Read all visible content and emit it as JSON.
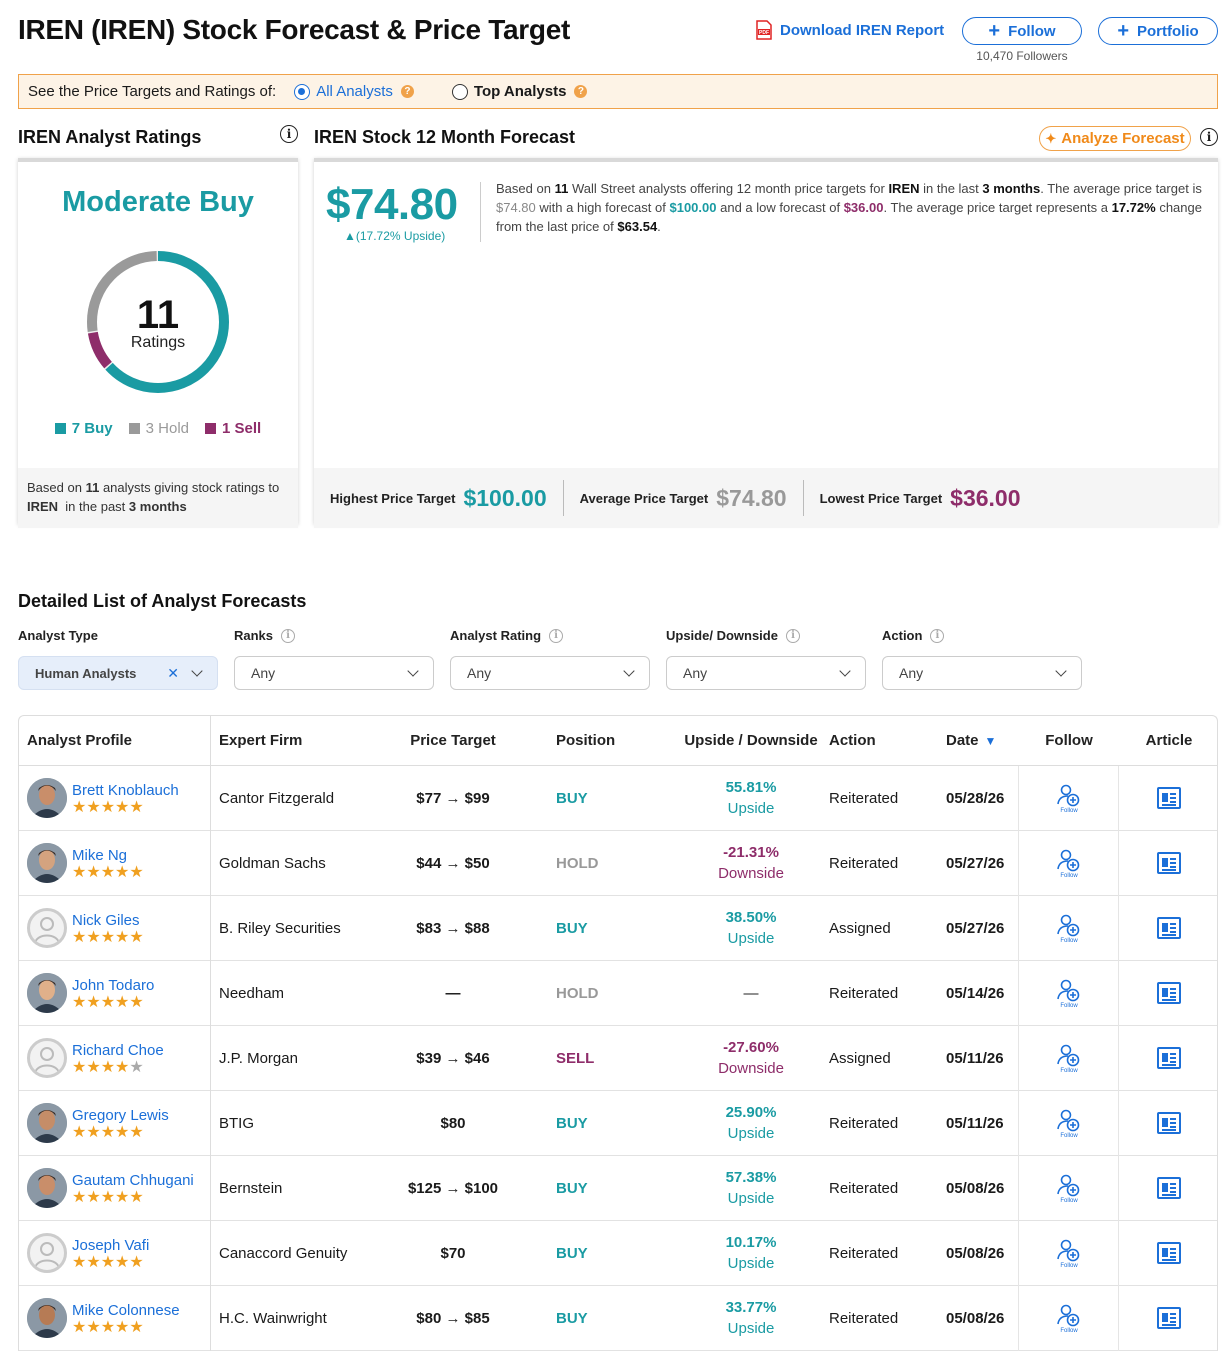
{
  "header": {
    "title": "IREN (IREN) Stock Forecast & Price Target",
    "download_label": "Download IREN Report",
    "follow_label": "Follow",
    "portfolio_label": "Portfolio",
    "followers": "10,470 Followers"
  },
  "filter": {
    "prompt": "See the Price Targets and Ratings of:",
    "all_analysts": "All Analysts",
    "top_analysts": "Top Analysts",
    "selected": "All Analysts"
  },
  "ratings": {
    "title": "IREN Analyst Ratings",
    "consensus": "Moderate Buy",
    "count": "11",
    "count_word": "Ratings",
    "buy": 7,
    "hold": 3,
    "sell": 1,
    "buy_label": "7 Buy",
    "hold_label": "3 Hold",
    "sell_label": "1 Sell",
    "colors": {
      "buy": "#1a9ba3",
      "hold": "#9a9a9a",
      "sell": "#8e2d6a"
    },
    "foot_1": "Based on",
    "foot_n": "11",
    "foot_2": "analysts giving stock ratings to",
    "foot_ticker": "IREN",
    "foot_3": "in the past",
    "foot_period": "3 months"
  },
  "forecast": {
    "title": "IREN Stock 12 Month Forecast",
    "analyze_label": "Analyze Forecast",
    "average": "$74.80",
    "upside": "▲(17.72% Upside)",
    "desc": {
      "p1": "Based on",
      "n": "11",
      "p2": "Wall Street analysts offering 12 month price targets for",
      "ticker": "IREN",
      "p3": "in the last",
      "period": "3 months",
      "p4": ". The average price target is",
      "avg": "$74.80",
      "p5": "with a high forecast of",
      "high": "$100.00",
      "p6": "and a low forecast of",
      "low": "$36.00",
      "p7": ". The average price target represents a",
      "pct": "17.72%",
      "p8": "change from the last price of",
      "last": "$63.54",
      "p9": "."
    },
    "highest_label": "Highest Price Target",
    "highest": "$100.00",
    "average_label": "Average Price Target",
    "average_val": "$74.80",
    "lowest_label": "Lowest Price Target",
    "lowest": "$36.00"
  },
  "list": {
    "title": "Detailed List of Analyst Forecasts",
    "filters": {
      "analyst_type_label": "Analyst Type",
      "analyst_type_value": "Human Analysts",
      "ranks_label": "Ranks",
      "ranks_value": "Any",
      "rating_label": "Analyst Rating",
      "rating_value": "Any",
      "updown_label": "Upside/ Downside",
      "updown_value": "Any",
      "action_label": "Action",
      "action_value": "Any"
    },
    "columns": {
      "profile": "Analyst Profile",
      "firm": "Expert Firm",
      "target": "Price Target",
      "position": "Position",
      "updown": "Upside / Downside",
      "action": "Action",
      "date": "Date",
      "follow": "Follow",
      "article": "Article"
    },
    "follow_caption": "Follow",
    "rows": [
      {
        "name": "Brett Knoblauch",
        "stars": 5,
        "firm": "Cantor Fitzgerald",
        "target": "$77 → $99",
        "position": "BUY",
        "pct": "55.81%",
        "dir": "Upside",
        "action": "Reiterated",
        "date": "05/28/26",
        "avatar": "photo"
      },
      {
        "name": "Mike Ng",
        "stars": 5,
        "firm": "Goldman Sachs",
        "target": "$44 → $50",
        "position": "HOLD",
        "pct": "-21.31%",
        "dir": "Downside",
        "action": "Reiterated",
        "date": "05/27/26",
        "avatar": "photo"
      },
      {
        "name": "Nick Giles",
        "stars": 5,
        "firm": "B. Riley Securities",
        "target": "$83 → $88",
        "position": "BUY",
        "pct": "38.50%",
        "dir": "Upside",
        "action": "Assigned",
        "date": "05/27/26",
        "avatar": "generic"
      },
      {
        "name": "John Todaro",
        "stars": 5,
        "firm": "Needham",
        "target": "—",
        "position": "HOLD",
        "pct": "—",
        "dir": "",
        "action": "Reiterated",
        "date": "05/14/26",
        "avatar": "photo"
      },
      {
        "name": "Richard Choe",
        "stars": 4.5,
        "firm": "J.P. Morgan",
        "target": "$39 → $46",
        "position": "SELL",
        "pct": "-27.60%",
        "dir": "Downside",
        "action": "Assigned",
        "date": "05/11/26",
        "avatar": "generic"
      },
      {
        "name": "Gregory Lewis",
        "stars": 5,
        "firm": "BTIG",
        "target": "$80",
        "position": "BUY",
        "pct": "25.90%",
        "dir": "Upside",
        "action": "Reiterated",
        "date": "05/11/26",
        "avatar": "photo"
      },
      {
        "name": "Gautam Chhugani",
        "stars": 5,
        "firm": "Bernstein",
        "target": "$125 → $100",
        "position": "BUY",
        "pct": "57.38%",
        "dir": "Upside",
        "action": "Reiterated",
        "date": "05/08/26",
        "avatar": "photo"
      },
      {
        "name": "Joseph Vafi",
        "stars": 5,
        "firm": "Canaccord Genuity",
        "target": "$70",
        "position": "BUY",
        "pct": "10.17%",
        "dir": "Upside",
        "action": "Reiterated",
        "date": "05/08/26",
        "avatar": "generic"
      },
      {
        "name": "Mike Colonnese",
        "stars": 5,
        "firm": "H.C. Wainwright",
        "target": "$80 → $85",
        "position": "BUY",
        "pct": "33.77%",
        "dir": "Upside",
        "action": "Reiterated",
        "date": "05/08/26",
        "avatar": "photo"
      }
    ]
  }
}
